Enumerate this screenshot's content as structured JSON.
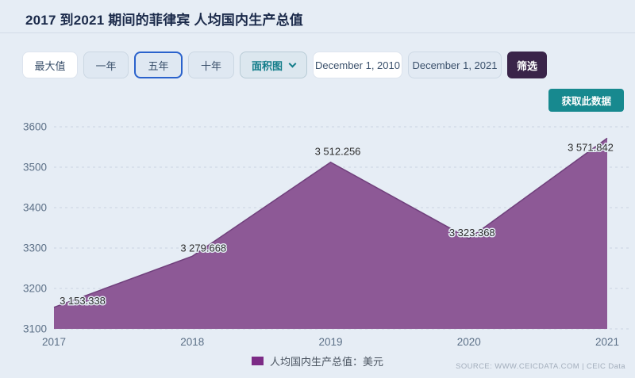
{
  "header": {
    "title": "2017 到2021 期间的菲律宾 人均国内生产总值"
  },
  "toolbar": {
    "range_buttons": [
      "最大值",
      "一年",
      "五年",
      "十年"
    ],
    "selected_range": "五年",
    "chart_type": "面积图",
    "date_from": "December 1, 2010",
    "date_to": "December 1, 2021",
    "filter_label": "筛选",
    "get_data_label": "获取此数据"
  },
  "chart_data": {
    "type": "area",
    "categories": [
      "2017",
      "2018",
      "2019",
      "2020",
      "2021"
    ],
    "series": [
      {
        "name": "人均国内生产总值：美元",
        "values": [
          3153.338,
          3279.668,
          3512.256,
          3323.368,
          3571.842
        ]
      }
    ],
    "point_labels": [
      "3 153.338",
      "3 279.668",
      "3 512.256",
      "3 323.368",
      "3 571.842"
    ],
    "ylim": [
      3100,
      3600
    ],
    "y_ticks": [
      3600,
      3500,
      3400,
      3300,
      3200,
      3100
    ],
    "grid": "dashed-horizontal",
    "legend_position": "bottom-center",
    "colors": {
      "area_fill": "#8d5996",
      "area_stroke": "#70407c",
      "legend_swatch": "#7c2b86"
    },
    "label_offsets": [
      [
        36,
        -4
      ],
      [
        14,
        -6
      ],
      [
        9,
        -9
      ],
      [
        4,
        -3
      ],
      [
        -21,
        16
      ]
    ]
  },
  "legend": {
    "label": "人均国内生产总值：美元"
  },
  "footer": {
    "source": "SOURCE: WWW.CEICDATA.COM | CEIC Data"
  }
}
